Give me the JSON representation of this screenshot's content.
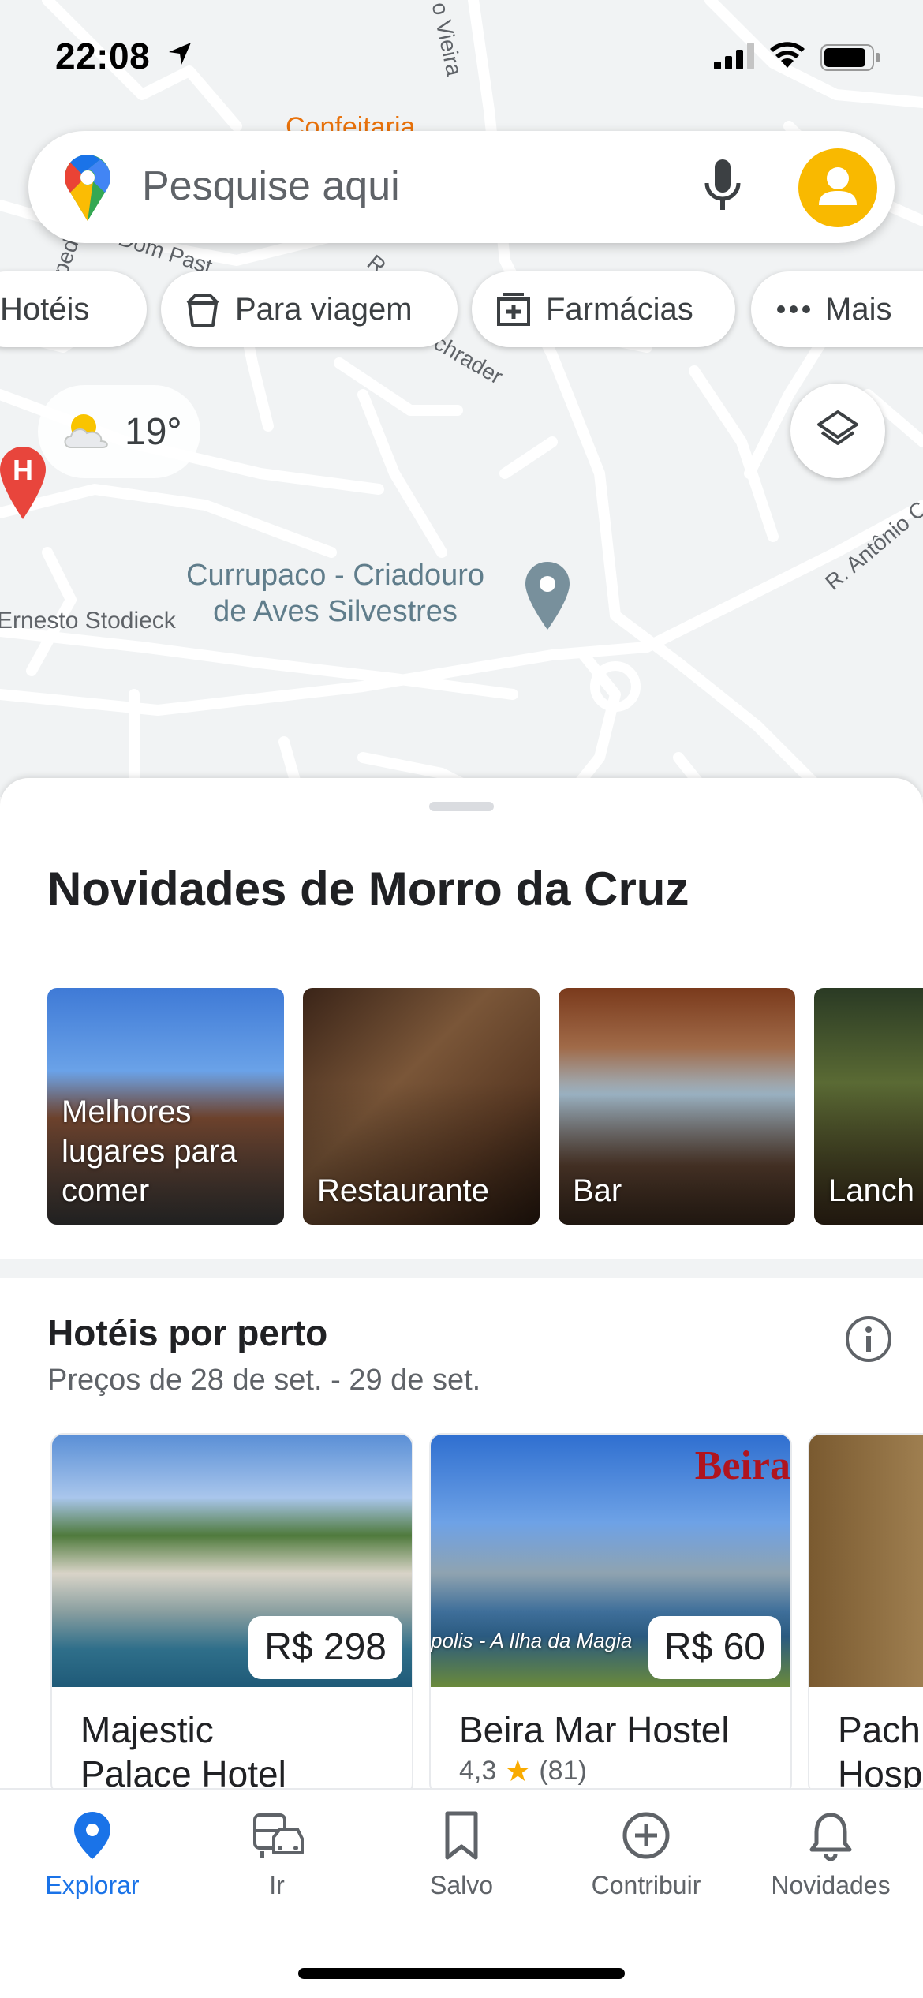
{
  "status_bar": {
    "time": "22:08"
  },
  "search": {
    "placeholder": "Pesquise aqui"
  },
  "chips": [
    {
      "label": "Hotéis",
      "icon": "bed-icon"
    },
    {
      "label": "Para viagem",
      "icon": "takeout-bag-icon"
    },
    {
      "label": "Farmácias",
      "icon": "pharmacy-icon"
    },
    {
      "label": "Mais",
      "icon": "more-dots-icon"
    }
  ],
  "weather": {
    "temperature": "19°",
    "icon": "partly-cloudy-icon"
  },
  "map": {
    "labels": {
      "confeitaria": "Confeitaria",
      "vieira": "o Vieira",
      "dom_past": "Dom Past",
      "chrader": "chrader",
      "ped": "ped",
      "r": "R.",
      "antonio": "R. Antônio C",
      "ernesto": "Ernesto Stodieck"
    },
    "poi": {
      "name_line1": "Currupaco - Criadouro",
      "name_line2": "de Aves Silvestres"
    }
  },
  "sheet": {
    "title": "Novidades de Morro da Cruz",
    "categories": [
      {
        "label": "Melhores lugares para comer"
      },
      {
        "label": "Restaurante"
      },
      {
        "label": "Bar"
      },
      {
        "label": "Lanch"
      }
    ],
    "hotels_section": {
      "title": "Hotéis por perto",
      "subtitle": "Preços de 28 de set. - 29 de set.",
      "hotels": [
        {
          "name_line1": "Majestic",
          "name_line2": "Palace Hotel",
          "price": "R$ 298"
        },
        {
          "name": "Beira Mar Hostel",
          "price": "R$ 60",
          "rating": "4,3",
          "reviews": "(81)",
          "photo_caption": "polis - A Ilha da Magia",
          "brand": "Beira"
        },
        {
          "name_line1": "Pach",
          "name_line2": "Hosp"
        }
      ]
    }
  },
  "bottom_nav": [
    {
      "label": "Explorar",
      "active": true
    },
    {
      "label": "Ir",
      "active": false
    },
    {
      "label": "Salvo",
      "active": false
    },
    {
      "label": "Contribuir",
      "active": false
    },
    {
      "label": "Novidades",
      "active": false
    }
  ],
  "colors": {
    "accent": "#1a73e8",
    "avatar": "#f9b900",
    "star": "#f9ab00"
  }
}
